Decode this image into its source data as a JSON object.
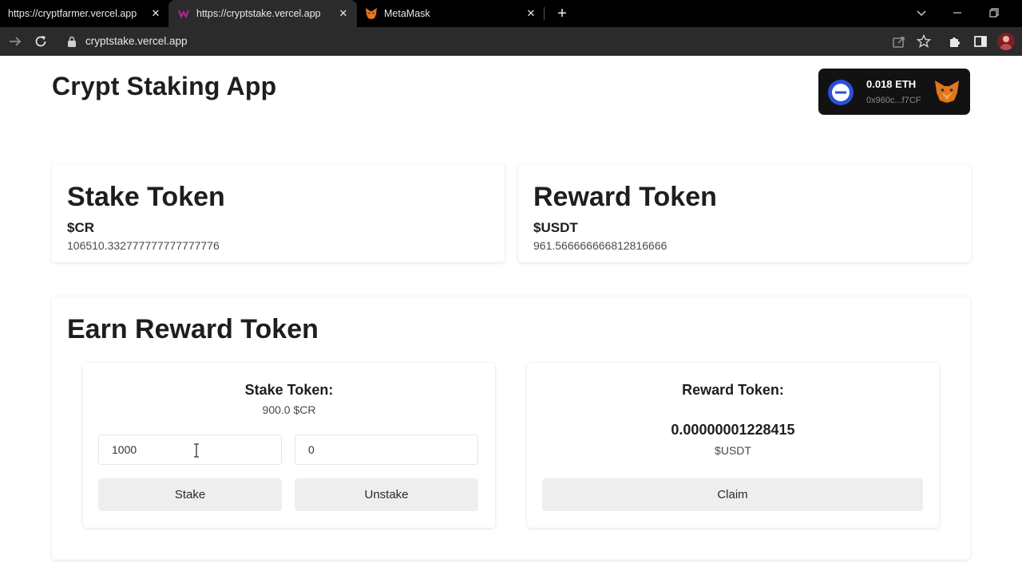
{
  "browser": {
    "tabs": [
      {
        "title": "https://cryptfarmer.vercel.app",
        "active": false
      },
      {
        "title": "https://cryptstake.vercel.app",
        "active": true
      },
      {
        "title": "MetaMask",
        "active": false
      }
    ],
    "url": "cryptstake.vercel.app",
    "colors": {
      "tabbar": "#000000",
      "toolbar": "#2b2b2b"
    }
  },
  "app": {
    "title": "Crypt Staking App"
  },
  "wallet": {
    "balance": "0.018 ETH",
    "address": "0x960c...f7CF",
    "network_icon": "ethereum-network-icon",
    "wallet_icon": "metamask-fox-icon"
  },
  "stake_token": {
    "heading": "Stake Token",
    "symbol": "$CR",
    "amount": "106510.332777777777777776"
  },
  "reward_token": {
    "heading": "Reward Token",
    "symbol": "$USDT",
    "amount": "961.566666666812816666"
  },
  "earn": {
    "heading": "Earn Reward Token",
    "stake_panel": {
      "label": "Stake Token:",
      "staked": "900.0 $CR",
      "stake_input_value": "1000",
      "unstake_input_value": "0",
      "stake_button": "Stake",
      "unstake_button": "Unstake"
    },
    "reward_panel": {
      "label": "Reward Token:",
      "value": "0.00000001228415",
      "unit": "$USDT",
      "claim_button": "Claim"
    }
  }
}
